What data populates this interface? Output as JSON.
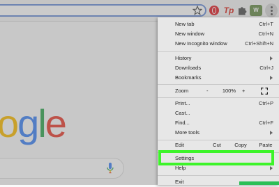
{
  "toolbar": {
    "tp_label": "Tp",
    "profile_label": "W",
    "colors": {
      "accent_blue": "#6c8fd6",
      "highlight_green": "#3df42a",
      "opera_red": "#e2252b"
    }
  },
  "page": {
    "logo_chars": [
      "o",
      "g",
      "l",
      "e"
    ]
  },
  "menu": {
    "new_tab": {
      "label": "New tab",
      "shortcut": "Ctrl+T"
    },
    "new_window": {
      "label": "New window",
      "shortcut": "Ctrl+N"
    },
    "new_incognito": {
      "label": "New Incognito window",
      "shortcut": "Ctrl+Shift+N"
    },
    "history": {
      "label": "History"
    },
    "downloads": {
      "label": "Downloads",
      "shortcut": "Ctrl+J"
    },
    "bookmarks": {
      "label": "Bookmarks"
    },
    "zoom": {
      "label": "Zoom",
      "minus": "-",
      "value": "100%",
      "plus": "+"
    },
    "print": {
      "label": "Print...",
      "shortcut": "Ctrl+P"
    },
    "cast": {
      "label": "Cast..."
    },
    "find": {
      "label": "Find...",
      "shortcut": "Ctrl+F"
    },
    "more_tools": {
      "label": "More tools"
    },
    "edit": {
      "label": "Edit",
      "cut": "Cut",
      "copy": "Copy",
      "paste": "Paste"
    },
    "settings": {
      "label": "Settings"
    },
    "help": {
      "label": "Help"
    },
    "exit": {
      "label": "Exit"
    }
  }
}
